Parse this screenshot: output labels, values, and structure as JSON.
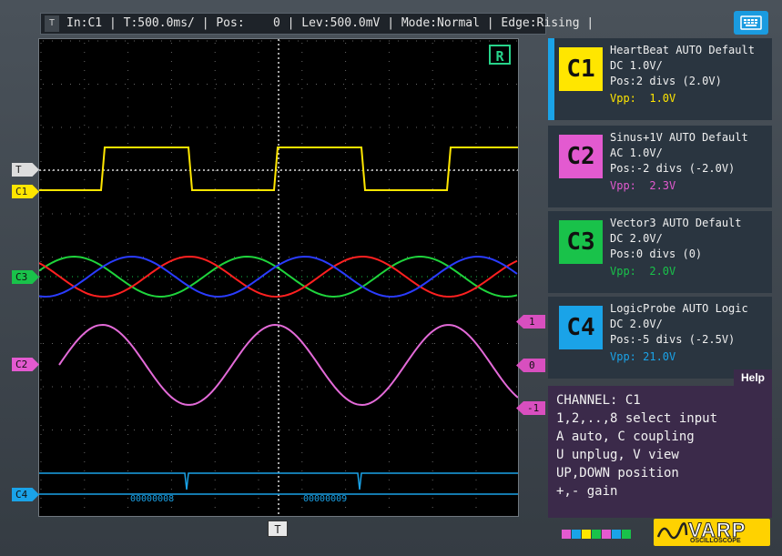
{
  "topbar": {
    "tab": "T",
    "status": "In:C1 | T:500.0ms/ | Pos:    0 | Lev:500.0mV | Mode:Normal | Edge:Rising |"
  },
  "screen": {
    "badge": "R",
    "c4_decode": [
      "00000008",
      "00000009"
    ]
  },
  "markers": {
    "trigger": "T",
    "c1": "C1",
    "c3": "C3",
    "c2": "C2",
    "c4": "C4",
    "level_plus1": "1",
    "level_zero": "0",
    "level_minus1": "-1",
    "bottom_trigger": "T"
  },
  "channels": [
    {
      "id": "C1",
      "color": "#ffe600",
      "name_line": "HeartBeat AUTO Default",
      "coupling": "DC 1.0V/",
      "pos": "Pos:2 divs (2.0V)",
      "vpp": "Vpp:  1.0V"
    },
    {
      "id": "C2",
      "color": "#e35ad0",
      "name_line": "Sinus+1V AUTO Default",
      "coupling": "AC 1.0V/",
      "pos": "Pos:-2 divs (-2.0V)",
      "vpp": "Vpp:  2.3V"
    },
    {
      "id": "C3",
      "color": "#19c24a",
      "name_line": "Vector3 AUTO Default",
      "coupling": "DC 2.0V/",
      "pos": "Pos:0 divs (0)",
      "vpp": "Vpp:  2.0V"
    },
    {
      "id": "C4",
      "color": "#1aa3e8",
      "name_line": "LogicProbe AUTO Logic",
      "coupling": "DC 2.0V/",
      "pos": "Pos:-5 divs (-2.5V)",
      "vpp": "Vpp: 21.0V"
    }
  ],
  "help": {
    "tab": "Help",
    "lines": [
      "CHANNEL: C1",
      "1,2,..,8 select input",
      "A auto, C coupling",
      "U unplug, V view",
      "UP,DOWN position",
      "+,- gain"
    ]
  },
  "logo": {
    "word": "VARP",
    "sub": "OSCILLOSCOPE"
  },
  "icons": {
    "keyboard": "keyboard-icon",
    "logo": "varp-wave-icon"
  }
}
